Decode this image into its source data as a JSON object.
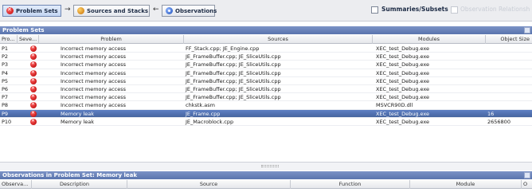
{
  "toolbar": {
    "problem_sets_label": "Problem Sets",
    "arrow_right": "→",
    "sources_label": "Sources and Stacks",
    "arrow_left": "←",
    "observations_label": "Observations",
    "summaries_label": "Summaries/Subsets",
    "observation_relationships_label": "Observation Relationships"
  },
  "problem_sets_panel": {
    "title": "Problem Sets",
    "columns": {
      "pro": "Pro...",
      "sev": "Seve...",
      "problem": "Problem",
      "sources": "Sources",
      "modules": "Modules",
      "object_size": "Object Size"
    },
    "rows": [
      {
        "id": "P1",
        "problem": "Incorrect memory access",
        "sources": "FF_Stack.cpp; JE_Engine.cpp",
        "modules": "XEC_test_Debug.exe",
        "size": ""
      },
      {
        "id": "P2",
        "problem": "Incorrect memory access",
        "sources": "JE_FrameBuffer.cpp; JE_SliceUtils.cpp",
        "modules": "XEC_test_Debug.exe",
        "size": ""
      },
      {
        "id": "P3",
        "problem": "Incorrect memory access",
        "sources": "JE_FrameBuffer.cpp; JE_SliceUtils.cpp",
        "modules": "XEC_test_Debug.exe",
        "size": ""
      },
      {
        "id": "P4",
        "problem": "Incorrect memory access",
        "sources": "JE_FrameBuffer.cpp; JE_SliceUtils.cpp",
        "modules": "XEC_test_Debug.exe",
        "size": ""
      },
      {
        "id": "P5",
        "problem": "Incorrect memory access",
        "sources": "JE_FrameBuffer.cpp; JE_SliceUtils.cpp",
        "modules": "XEC_test_Debug.exe",
        "size": ""
      },
      {
        "id": "P6",
        "problem": "Incorrect memory access",
        "sources": "JE_FrameBuffer.cpp; JE_SliceUtils.cpp",
        "modules": "XEC_test_Debug.exe",
        "size": ""
      },
      {
        "id": "P7",
        "problem": "Incorrect memory access",
        "sources": "JE_FrameBuffer.cpp; JE_SliceUtils.cpp",
        "modules": "XEC_test_Debug.exe",
        "size": ""
      },
      {
        "id": "P8",
        "problem": "Incorrect memory access",
        "sources": "chkstk.asm",
        "modules": "MSVCR90D.dll",
        "size": ""
      },
      {
        "id": "P9",
        "problem": "Memory leak",
        "sources": "JE_Frame.cpp",
        "modules": "XEC_test_Debug.exe",
        "size": "16"
      },
      {
        "id": "P10",
        "problem": "Memory leak",
        "sources": "JE_Macroblock.cpp",
        "modules": "XEC_test_Debug.exe",
        "size": "2656800"
      }
    ],
    "selected_index": 8
  },
  "observations_panel": {
    "title": "Observations in Problem Set: Memory leak",
    "columns": {
      "observation": "Observa...",
      "description": "Description",
      "source": "Source",
      "function": "Function",
      "module": "Module",
      "extra": "O"
    }
  },
  "colors": {
    "selection": "#4f6fae",
    "panel_title": "#6480b8",
    "severity": "#c00000"
  }
}
